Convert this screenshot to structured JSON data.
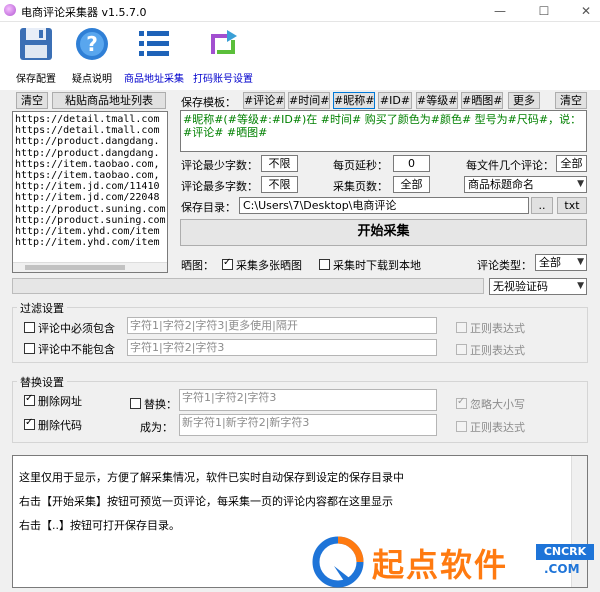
{
  "window": {
    "title": "电商评论采集器 v1.5.7.0",
    "min": "—",
    "max": "☐",
    "close": "✕"
  },
  "toolbar": {
    "save": "保存配置",
    "help": "疑点说明",
    "collect": "商品地址采集",
    "print": "打码账号设置"
  },
  "left": {
    "clear": "清空",
    "paste": "粘贴商品地址列表",
    "urls": [
      "https://detail.tmall.com",
      "https://detail.tmall.com",
      "http://product.dangdang.",
      "http://product.dangdang.",
      "https://item.taobao.com,",
      "https://item.taobao.com,",
      "http://item.jd.com/11410",
      "http://item.jd.com/22048",
      "http://product.suning.com",
      "http://product.suning.com",
      "http://item.yhd.com/item",
      "http://item.yhd.com/item"
    ]
  },
  "template": {
    "label": "保存模板：",
    "tags": [
      "#评论#",
      "#时间#",
      "#昵称#",
      "#ID#",
      "#等级#",
      "#晒图#"
    ],
    "more": "更多",
    "clear": "清空",
    "text": "#昵称#(#等级#:#ID#)在 #时间# 购买了颜色为#颜色# 型号为#尺码#，说：#评论# #晒图#"
  },
  "settings": {
    "min_words_label": "评论最少字数：",
    "min_words": "不限",
    "max_words_label": "评论最多字数：",
    "max_words": "不限",
    "delay_label": "每页延秒：",
    "delay": "0",
    "pages_label": "采集页数：",
    "pages": "全部",
    "per_file_label": "每文件几个评论：",
    "per_file": "全部",
    "naming": "商品标题命名",
    "dir_label": "保存目录：",
    "dir": "C:\\Users\\7\\Desktop\\电商评论",
    "browse": "..",
    "ext": "txt",
    "start": "开始采集"
  },
  "options": {
    "show_label": "晒图：",
    "multi_img": "采集多张晒图",
    "download_local": "采集时下载到本地",
    "type_label": "评论类型：",
    "type": "全部",
    "captcha": "无视验证码"
  },
  "filter": {
    "title": "过滤设置",
    "must_contain": "评论中必须包含",
    "must_contain_ph": "字符1|字符2|字符3|更多使用|隔开",
    "not_contain": "评论中不能包含",
    "not_contain_ph": "字符1|字符2|字符3",
    "regex1": "正则表达式",
    "regex2": "正则表达式"
  },
  "replace": {
    "title": "替换设置",
    "del_url": "删除网址",
    "del_code": "删除代码",
    "replace_label": "替换：",
    "replace_ph": "字符1|字符2|字符3",
    "become_label": "成为：",
    "become_ph": "新字符1|新字符2|新字符3",
    "ignore_case": "忽略大小写",
    "regex": "正则表达式"
  },
  "log": [
    "这里仅用于显示，方便了解采集情况，软件已实时自动保存到设定的保存目录中",
    "右击【开始采集】按钮可预览一页评论，每采集一页的评论内容都在这里显示",
    "右击【..】按钮可打开保存目录。"
  ],
  "watermark": {
    "brand": "起点软件",
    "site": "CNCRK",
    "domain": ".COM"
  }
}
